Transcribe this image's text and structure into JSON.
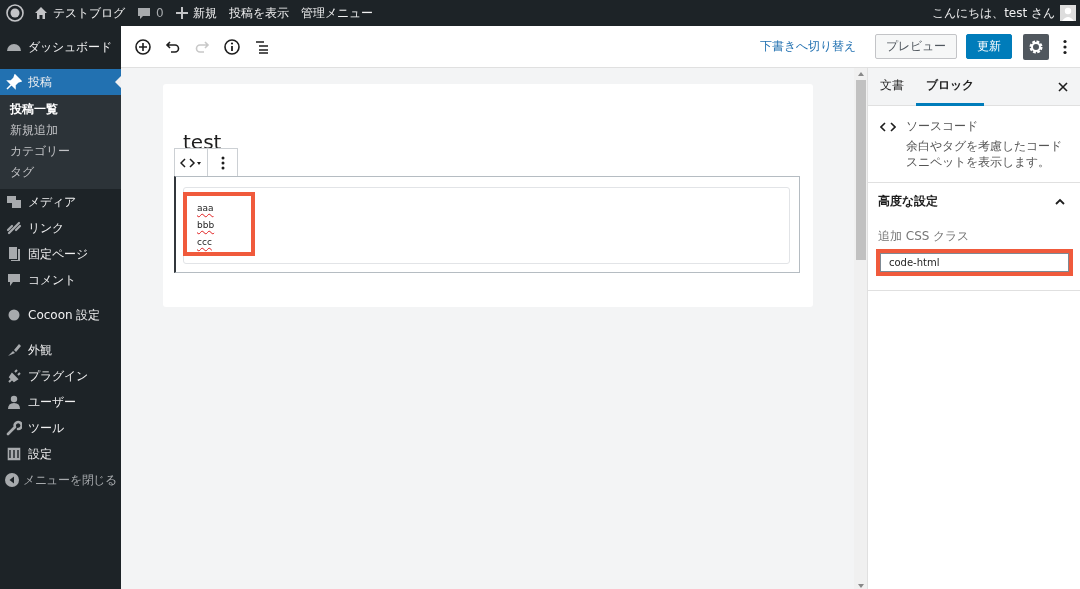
{
  "admin_bar": {
    "site": "テストブログ",
    "comments": "0",
    "new": "新規",
    "view": "投稿を表示",
    "admin_menu": "管理メニュー",
    "greeting": "こんにちは、test さん"
  },
  "sidebar": {
    "sections": [
      [
        {
          "label": "ダッシュボード",
          "selected": false
        }
      ],
      [
        {
          "label": "投稿",
          "selected": true,
          "children": [
            {
              "label": "投稿一覧",
              "selected": true
            },
            {
              "label": "新規追加",
              "selected": false
            },
            {
              "label": "カテゴリー",
              "selected": false
            },
            {
              "label": "タグ",
              "selected": false
            }
          ]
        },
        {
          "label": "メディア",
          "selected": false
        },
        {
          "label": "リンク",
          "selected": false
        },
        {
          "label": "固定ページ",
          "selected": false
        },
        {
          "label": "コメント",
          "selected": false
        }
      ],
      [
        {
          "label": "Cocoon 設定",
          "selected": false
        }
      ],
      [
        {
          "label": "外観",
          "selected": false
        },
        {
          "label": "プラグイン",
          "selected": false
        },
        {
          "label": "ユーザー",
          "selected": false
        },
        {
          "label": "ツール",
          "selected": false
        },
        {
          "label": "設定",
          "selected": false
        }
      ]
    ],
    "collapse": "メニューを閉じる"
  },
  "toolbar": {
    "redo_disabled": true,
    "switch_to_draft": "下書きへ切り替え",
    "preview": "プレビュー",
    "update": "更新",
    "settings_on": true
  },
  "editor": {
    "title": "test",
    "code_lines": [
      "aaa",
      "bbb",
      "ccc"
    ],
    "code_highlighted": true
  },
  "panel": {
    "tabs": [
      {
        "label": "文書",
        "selected": false
      },
      {
        "label": "ブロック",
        "selected": true
      }
    ],
    "block_name": "ソースコード",
    "block_description": "余白やタグを考慮したコードスニペットを表示します。",
    "advanced": {
      "title": "高度な設定",
      "expanded": true,
      "css_label": "追加 CSS クラス",
      "css_value": "code-html",
      "highlighted": true
    }
  }
}
